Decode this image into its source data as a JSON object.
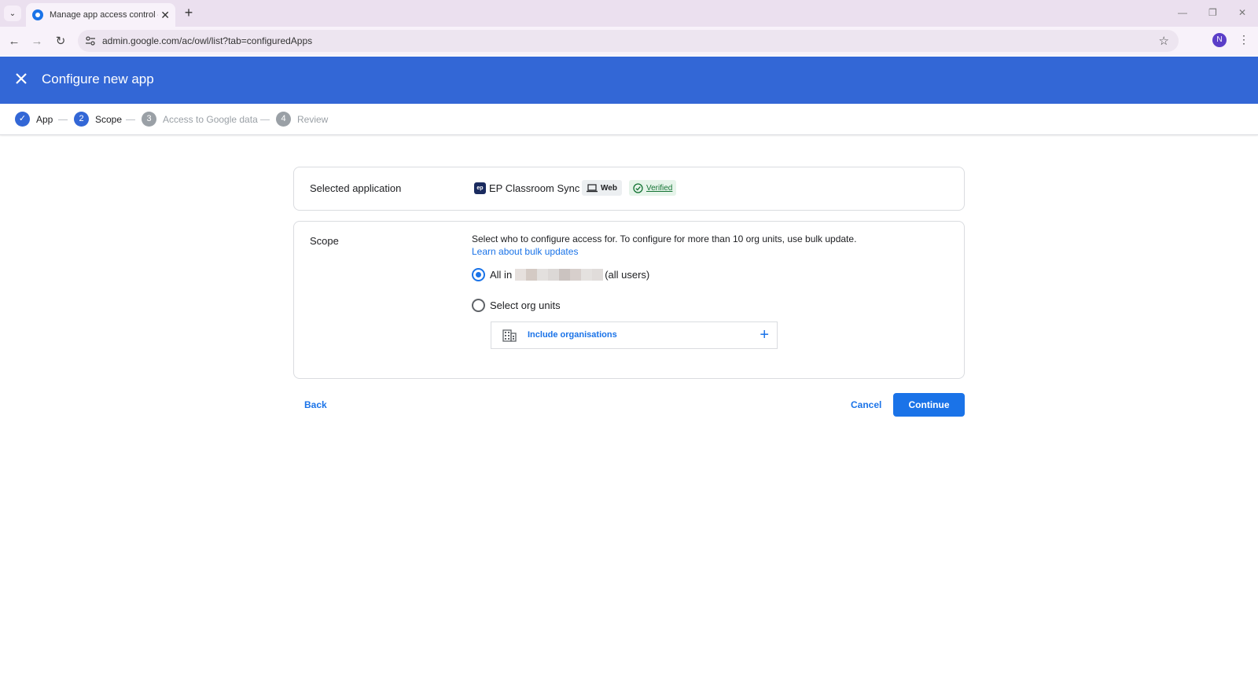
{
  "browser": {
    "tab_title": "Manage app access control – A",
    "url": "admin.google.com/ac/owl/list?tab=configuredApps",
    "profile_initial": "N"
  },
  "header": {
    "title": "Configure new app"
  },
  "stepper": {
    "steps": [
      {
        "label": "App",
        "marker": "✓",
        "state": "done"
      },
      {
        "label": "Scope",
        "marker": "2",
        "state": "current"
      },
      {
        "label": "Access to Google data",
        "marker": "3",
        "state": "upcoming"
      },
      {
        "label": "Review",
        "marker": "4",
        "state": "upcoming"
      }
    ]
  },
  "selected_application": {
    "label": "Selected application",
    "app_logo_text": "ep",
    "app_name": "EP Classroom Sync",
    "platform": "Web",
    "status": "Verified"
  },
  "scope": {
    "label": "Scope",
    "description": "Select who to configure access for. To configure for more than 10 org units, use bulk update.",
    "link": "Learn about bulk updates",
    "option_all_prefix": "All in",
    "option_all_suffix": "(all users)",
    "option_org_units": "Select org units",
    "selected_option": "all",
    "include_orgs": "Include organisations"
  },
  "footer": {
    "back": "Back",
    "cancel": "Cancel",
    "continue": "Continue"
  },
  "colors": {
    "header_bg": "#3367d6",
    "primary": "#1a73e8",
    "verified_green": "#137333"
  }
}
